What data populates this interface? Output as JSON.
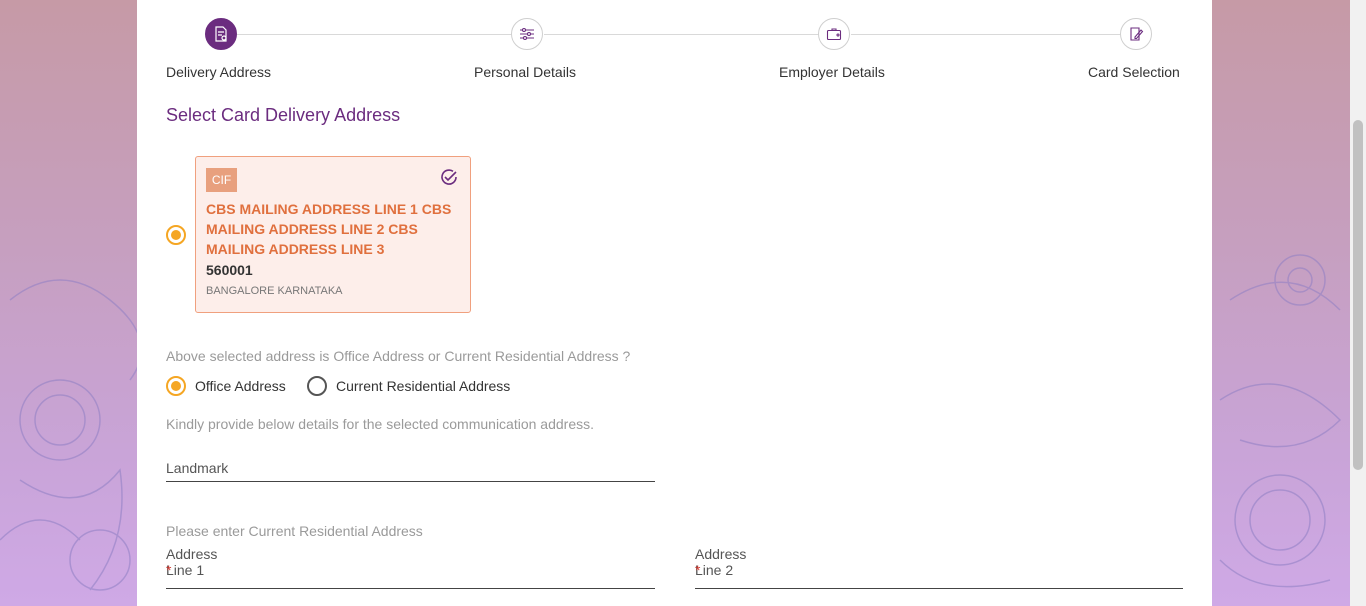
{
  "stepper": {
    "steps": [
      {
        "label": "Delivery Address",
        "icon": "document-icon",
        "active": true
      },
      {
        "label": "Personal Details",
        "icon": "sliders-icon",
        "active": false
      },
      {
        "label": "Employer Details",
        "icon": "briefcase-icon",
        "active": false
      },
      {
        "label": "Card Selection",
        "icon": "edit-doc-icon",
        "active": false
      }
    ]
  },
  "section": {
    "title": "Select Card Delivery Address"
  },
  "address_card": {
    "badge": "CIF",
    "lines": "CBS MAILING ADDRESS LINE 1 CBS MAILING ADDRESS LINE 2 CBS MAILING ADDRESS LINE 3",
    "pincode": "560001",
    "city_state": "BANGALORE KARNATAKA"
  },
  "address_type": {
    "question": "Above selected address is Office Address or Current Residential Address ?",
    "options": [
      "Office Address",
      "Current Residential Address"
    ],
    "selected": "Office Address"
  },
  "details": {
    "instruction": "Kindly provide below details for the selected communication address.",
    "landmark_label": "Landmark"
  },
  "residential": {
    "prompt": "Please enter Current Residential Address",
    "line1_label": "Address Line 1",
    "line2_label": "Address Line 2",
    "required_mark": "*"
  },
  "colors": {
    "brand_purple": "#6b2c7f",
    "accent_orange": "#f5a623",
    "card_text_orange": "#e0703e"
  }
}
